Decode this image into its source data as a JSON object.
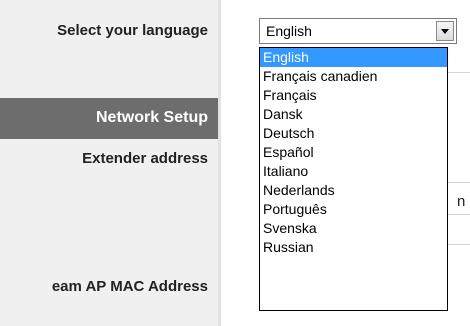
{
  "labels": {
    "select_language": "Select your language",
    "network_setup": "Network Setup",
    "extender_address": "Extender address",
    "mac_address": "eam AP MAC Address"
  },
  "language_select": {
    "value": "English",
    "options": [
      "English",
      "Français canadien",
      "Français",
      "Dansk",
      "Deutsch",
      "Español",
      "Italiano",
      "Nederlands",
      "Português",
      "Svenska",
      "Russian"
    ],
    "highlighted_option": "English"
  },
  "clipped_text": "n",
  "colors": {
    "left_panel": "#f0f0f0",
    "section_header": "#6d6d6d",
    "highlight": "#3399ff"
  },
  "icons": {
    "dropdown_arrow": "chevron-down-icon"
  }
}
